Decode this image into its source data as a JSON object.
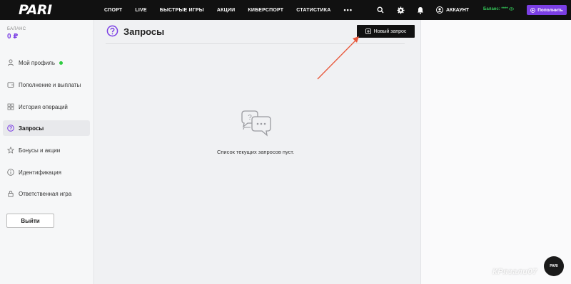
{
  "header": {
    "logo": "PARI",
    "nav": [
      "СПОРТ",
      "LIVE",
      "БЫСТРЫЕ ИГРЫ",
      "АКЦИИ",
      "КИБЕРСПОРТ",
      "СТАТИСТИКА"
    ],
    "more": "•••",
    "account_label": "АККАУНТ",
    "balance_label": "Баланс: ****",
    "topup_label": "Пополнить"
  },
  "sidebar": {
    "balance_label": "БАЛАНС",
    "balance_value": "0 ₽",
    "items": [
      {
        "label": "Мой профиль",
        "icon": "user-icon"
      },
      {
        "label": "Пополнение и выплаты",
        "icon": "wallet-icon"
      },
      {
        "label": "История операций",
        "icon": "grid-icon"
      },
      {
        "label": "Запросы",
        "icon": "question-icon"
      },
      {
        "label": "Бонусы и акции",
        "icon": "star-icon"
      },
      {
        "label": "Идентификация",
        "icon": "info-icon"
      },
      {
        "label": "Ответственная игра",
        "icon": "lock-icon"
      }
    ],
    "active_index": 3,
    "logout_label": "Выйти"
  },
  "main": {
    "title": "Запросы",
    "new_request_label": "Новый запрос",
    "empty_text": "Список текущих запросов пуст."
  },
  "watermark": "КРязали07",
  "colors": {
    "accent": "#7b3fe4",
    "topbar": "#111111",
    "annotation_arrow": "#e8573a",
    "online": "#2ecc40"
  }
}
